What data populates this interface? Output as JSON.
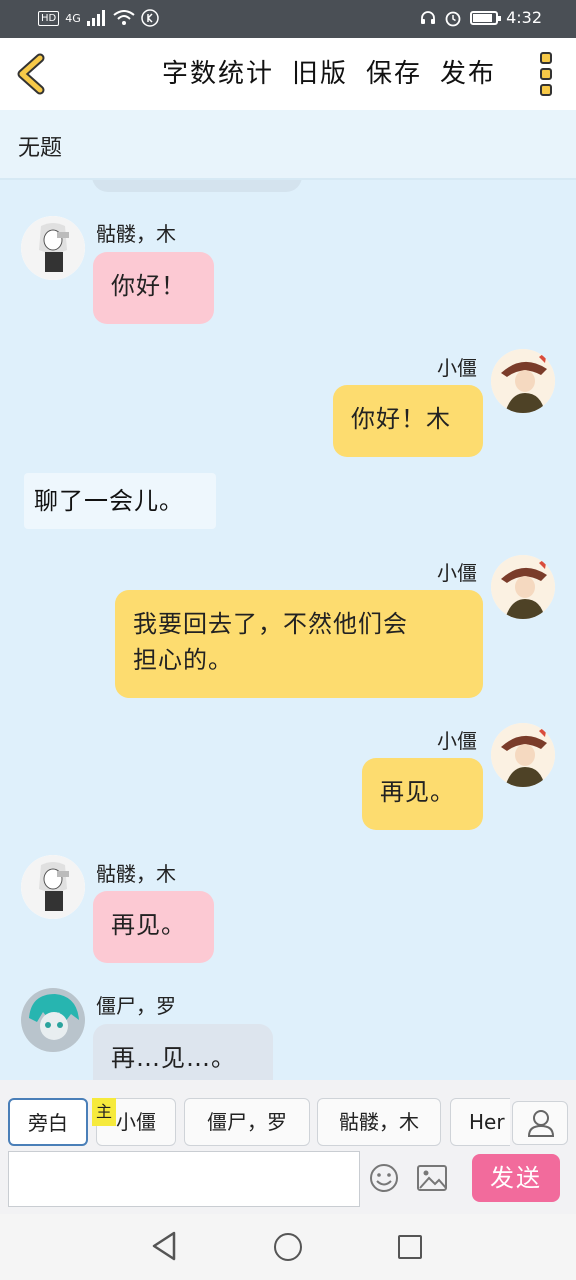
{
  "status_bar": {
    "network": "4G",
    "time": "4:32"
  },
  "toolbar": {
    "word_count": "字数统计",
    "old_version": "旧版",
    "save": "保存",
    "publish": "发布"
  },
  "title": "无题",
  "messages": [
    {
      "speaker": "骷髅，木",
      "text": "你好！",
      "side": "left",
      "color": "pink",
      "avatar_icon": "skeleton-avatar-icon"
    },
    {
      "speaker": "小僵",
      "text": "你好！木",
      "side": "right",
      "color": "yellow",
      "avatar_icon": "xiaojiang-avatar-icon"
    },
    {
      "narration": "聊了一会儿。"
    },
    {
      "speaker": "小僵",
      "text": "我要回去了，不然他们会\n担心的。",
      "side": "right",
      "color": "yellow",
      "avatar_icon": "xiaojiang-avatar-icon"
    },
    {
      "speaker": "小僵",
      "text": "再见。",
      "side": "right",
      "color": "yellow",
      "avatar_icon": "xiaojiang-avatar-icon"
    },
    {
      "speaker": "骷髅，木",
      "text": "再见。",
      "side": "left",
      "color": "pink",
      "avatar_icon": "skeleton-avatar-icon"
    },
    {
      "speaker": "僵尸，罗",
      "text": "再…见…。",
      "side": "left",
      "color": "gray",
      "avatar_icon": "zombie-avatar-icon"
    }
  ],
  "character_chips": [
    {
      "label": "旁白",
      "active": true
    },
    {
      "label": "小僵",
      "tag": "主"
    },
    {
      "label": "僵尸，罗"
    },
    {
      "label": "骷髅，木"
    },
    {
      "label": "Her"
    }
  ],
  "input": {
    "value": "",
    "placeholder": ""
  },
  "send_label": "发送",
  "colors": {
    "chat_bg": "#dff0fb",
    "bubble_pink": "#fcc9d3",
    "bubble_yellow": "#fddc6f",
    "bubble_gray": "#dde5ee",
    "send_button": "#f26b9c",
    "accent_back": "#f7c948"
  }
}
